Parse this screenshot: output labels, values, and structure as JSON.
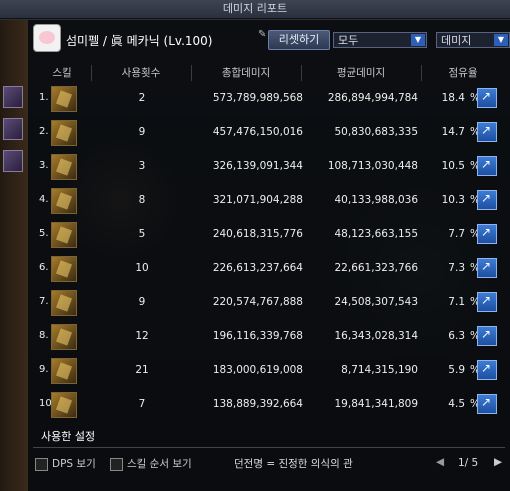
{
  "window": {
    "title": "데미지 리포트"
  },
  "header": {
    "character": "섬미펠 / 眞 메카닉 (Lv.100)",
    "reset_label": "리셋하기",
    "filter_select": "모두",
    "metric_select": "데미지"
  },
  "columns": {
    "skill": "스킬",
    "uses": "사용횟수",
    "total": "총합데미지",
    "avg": "평균데미지",
    "share": "점유율"
  },
  "rows": [
    {
      "num": "1.",
      "uses": "2",
      "total": "573,789,989,568",
      "avg": "286,894,994,784",
      "share": "18.4"
    },
    {
      "num": "2.",
      "uses": "9",
      "total": "457,476,150,016",
      "avg": "50,830,683,335",
      "share": "14.7"
    },
    {
      "num": "3.",
      "uses": "3",
      "total": "326,139,091,344",
      "avg": "108,713,030,448",
      "share": "10.5"
    },
    {
      "num": "4.",
      "uses": "8",
      "total": "321,071,904,288",
      "avg": "40,133,988,036",
      "share": "10.3"
    },
    {
      "num": "5.",
      "uses": "5",
      "total": "240,618,315,776",
      "avg": "48,123,663,155",
      "share": "7.7"
    },
    {
      "num": "6.",
      "uses": "10",
      "total": "226,613,237,664",
      "avg": "22,661,323,766",
      "share": "7.3"
    },
    {
      "num": "7.",
      "uses": "9",
      "total": "220,574,767,888",
      "avg": "24,508,307,543",
      "share": "7.1"
    },
    {
      "num": "8.",
      "uses": "12",
      "total": "196,116,339,768",
      "avg": "16,343,028,314",
      "share": "6.3"
    },
    {
      "num": "9.",
      "uses": "21",
      "total": "183,000,619,008",
      "avg": "8,714,315,190",
      "share": "5.9"
    },
    {
      "num": "10.",
      "uses": "7",
      "total": "138,889,392,664",
      "avg": "19,841,341,809",
      "share": "4.5"
    }
  ],
  "share_unit": "%",
  "footer": {
    "used_setting": "사용한 설정",
    "dps_label": "DPS 보기",
    "order_label": "스킬 순서 보기",
    "title_text": "던전명 = 진정한 의식의 관",
    "page": "1/ 5"
  },
  "icons": {
    "dropdown": "chevron-down-icon",
    "detail": "external-link-icon",
    "pin": "pin-icon",
    "prev": "arrow-left-icon",
    "next": "arrow-right-icon"
  }
}
